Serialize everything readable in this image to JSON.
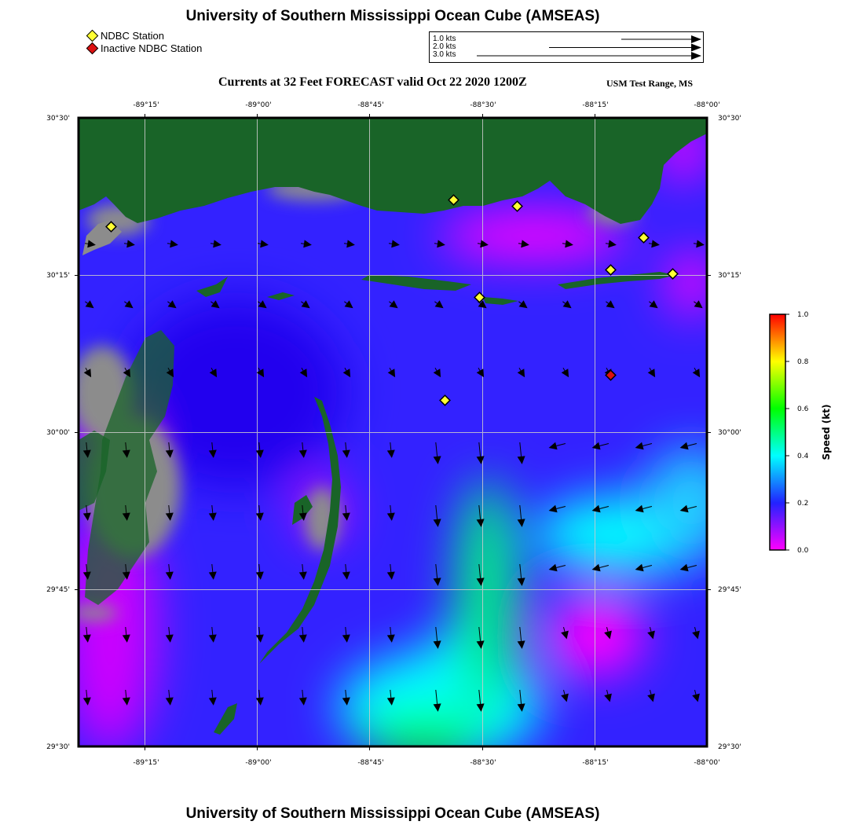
{
  "header": {
    "title": "University of Southern Mississippi Ocean Cube (AMSEAS)",
    "subtitle": "Currents at 32 Feet FORECAST valid Oct 22 2020 1200Z",
    "region": "USM Test Range, MS"
  },
  "footer": {
    "title": "University of Southern Mississippi Ocean Cube (AMSEAS)"
  },
  "legend": {
    "active": {
      "label": "NDBC Station",
      "color": "#ffff33"
    },
    "inactive": {
      "label": "Inactive NDBC Station",
      "color": "#dd1111"
    }
  },
  "vector_legend": {
    "items": [
      {
        "label": "1.0 kts",
        "value": 1.0
      },
      {
        "label": "2.0 kts",
        "value": 2.0
      },
      {
        "label": "3.0 kts",
        "value": 3.0
      }
    ]
  },
  "axes": {
    "lon_ticks": [
      "-89°15'",
      "-89°00'",
      "-88°45'",
      "-88°30'",
      "-88°15'",
      "-88°00'"
    ],
    "lat_ticks": [
      "30°30'",
      "30°15'",
      "30°00'",
      "29°45'",
      "29°30'"
    ],
    "lon_range": [
      -89.3333,
      -88.0
    ],
    "lat_range": [
      29.5,
      30.5
    ]
  },
  "colorbar": {
    "label": "Speed (kt)",
    "ticks": [
      "1.0",
      "0.8",
      "0.6",
      "0.4",
      "0.2",
      "0.0"
    ],
    "range": [
      0.0,
      1.0
    ]
  },
  "colors": {
    "land": "#196428",
    "marsh": "#8c8c8c",
    "slow": "#ff00ff",
    "mid": "#3322ff",
    "fast": "#00ff00"
  }
}
